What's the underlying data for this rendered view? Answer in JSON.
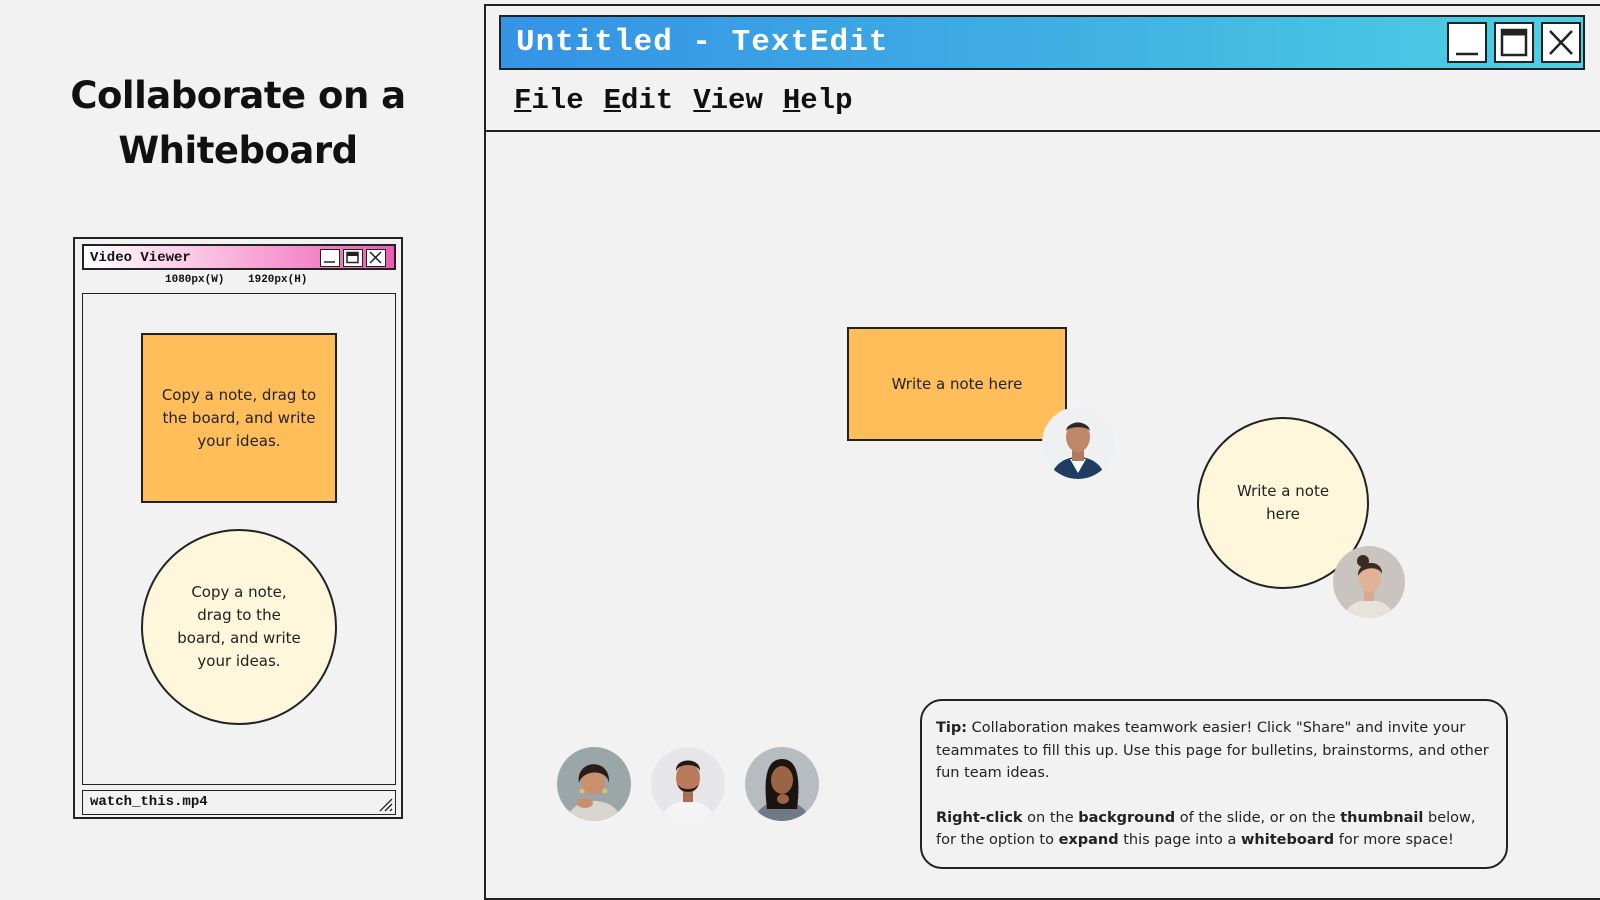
{
  "heading": {
    "line1": "Collaborate on a",
    "line2": "Whiteboard"
  },
  "video_viewer": {
    "title": "Video Viewer",
    "width_label": "1080px(W)",
    "height_label": "1920px(H)",
    "rect_note": "Copy a note, drag to the board, and write your ideas.",
    "circle_note": "Copy a note, drag to the board, and write your ideas.",
    "filename": "watch_this.mp4"
  },
  "textedit": {
    "title": "Untitled - TextEdit",
    "menu": [
      {
        "first": "F",
        "rest": "ile"
      },
      {
        "first": "E",
        "rest": "dit"
      },
      {
        "first": "V",
        "rest": "iew"
      },
      {
        "first": "H",
        "rest": "elp"
      }
    ],
    "rect_note": "Write a note here",
    "circle_note": "Write a note here"
  },
  "tip": {
    "p1_bold": "Tip:",
    "p1_text": " Collaboration makes teamwork easier! Click \"Share\" and invite your teammates to fill this up. Use this page for bulletins, brainstorms, and other fun team ideas.",
    "p2": [
      {
        "b": "Right-click"
      },
      {
        "t": " on the "
      },
      {
        "b": "background"
      },
      {
        "t": " of the slide, or on the "
      },
      {
        "b": "thumbnail"
      },
      {
        "t": " below, for the option to "
      },
      {
        "b": "expand"
      },
      {
        "t": " this page into a "
      },
      {
        "b": "whiteboard"
      },
      {
        "t": " for more space!"
      }
    ]
  },
  "colors": {
    "note_orange": "#ffbe5a",
    "note_cream": "#fef7dc",
    "textedit_title_start": "#3593e6",
    "textedit_title_end": "#4fd0e4",
    "viewer_title_end": "#ee5ab3"
  }
}
